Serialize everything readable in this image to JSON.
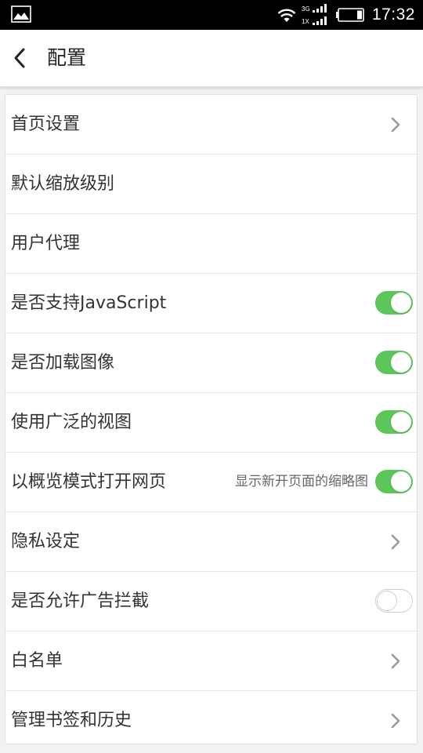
{
  "status_bar": {
    "time": "17:32",
    "signal_top_label": "3G",
    "signal_bottom_label": "1X",
    "icons": [
      "gallery-icon",
      "wifi-icon",
      "signal-icon",
      "battery-icon"
    ]
  },
  "header": {
    "title": "配置",
    "back_icon": "back-arrow-icon"
  },
  "settings": [
    {
      "label": "首页设置",
      "control": "chevron"
    },
    {
      "label": "默认缩放级别",
      "control": "none"
    },
    {
      "label": "用户代理",
      "control": "none"
    },
    {
      "label": "是否支持JavaScript",
      "control": "toggle",
      "on": true
    },
    {
      "label": "是否加载图像",
      "control": "toggle",
      "on": true
    },
    {
      "label": "使用广泛的视图",
      "control": "toggle",
      "on": true
    },
    {
      "label": "以概览模式打开网页",
      "sublabel": "显示新开页面的缩略图",
      "control": "toggle",
      "on": true
    },
    {
      "label": "隐私设定",
      "control": "chevron"
    },
    {
      "label": "是否允许广告拦截",
      "control": "toggle",
      "on": false
    },
    {
      "label": "白名单",
      "control": "chevron"
    },
    {
      "label": "管理书签和历史",
      "control": "chevron"
    }
  ],
  "colors": {
    "toggle_on": "#5cc65a",
    "chevron": "#9a9a9a",
    "background": "#f2f2f2"
  }
}
